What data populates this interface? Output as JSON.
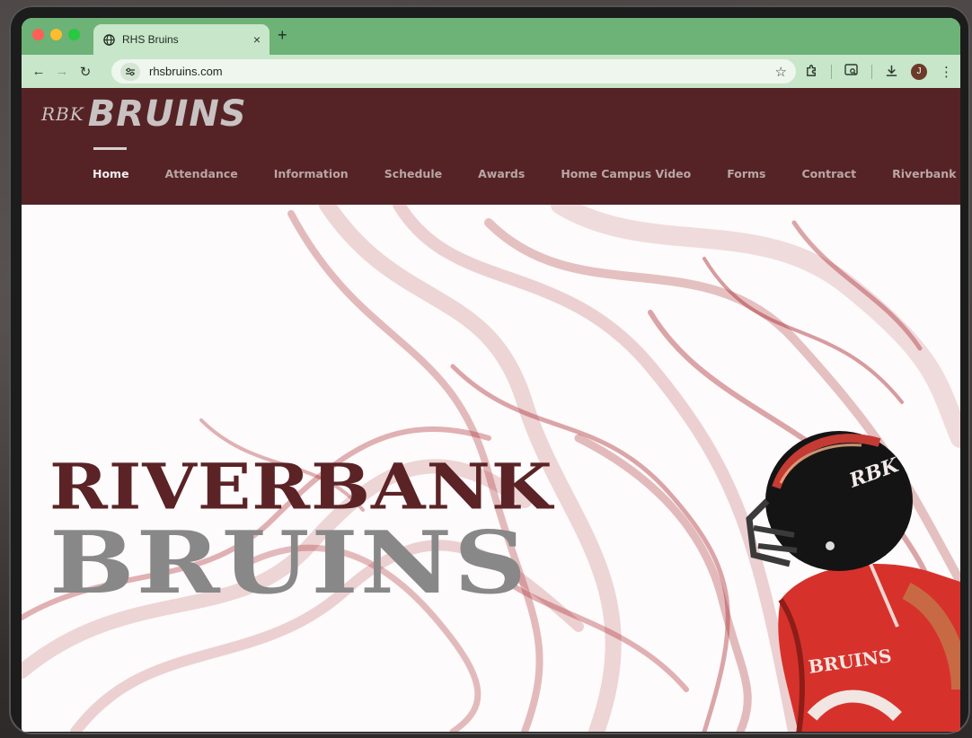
{
  "browser": {
    "tab_title": "RHS Bruins",
    "tab_close": "×",
    "new_tab": "+",
    "url": "rhsbruins.com",
    "account_initial": "J"
  },
  "site": {
    "logo_mark": "RBK",
    "logo_text": "BRUINS",
    "nav": [
      {
        "label": "Home",
        "active": true
      },
      {
        "label": "Attendance"
      },
      {
        "label": "Information"
      },
      {
        "label": "Schedule"
      },
      {
        "label": "Awards"
      },
      {
        "label": "Home Campus Video"
      },
      {
        "label": "Forms"
      },
      {
        "label": "Contract"
      },
      {
        "label": "Riverbank Outlaws"
      }
    ],
    "hero": {
      "line1": "RIVERBANK",
      "line2": "BRUINS",
      "jersey_text": "BRUINS",
      "helmet_text": "RBK"
    }
  },
  "colors": {
    "tabstrip": "#6db276",
    "toolbar": "#c8e6c9",
    "header": "#552326",
    "hero_title_primary": "#5b2326",
    "hero_title_secondary": "#888888",
    "smoke": "#a8262c",
    "jersey": "#d6322b"
  },
  "icons": [
    "globe-icon",
    "back-icon",
    "forward-icon",
    "reload-icon",
    "site-settings-icon",
    "bookmark-star-icon",
    "extensions-icon",
    "tab-search-icon",
    "download-icon",
    "menu-icon"
  ]
}
